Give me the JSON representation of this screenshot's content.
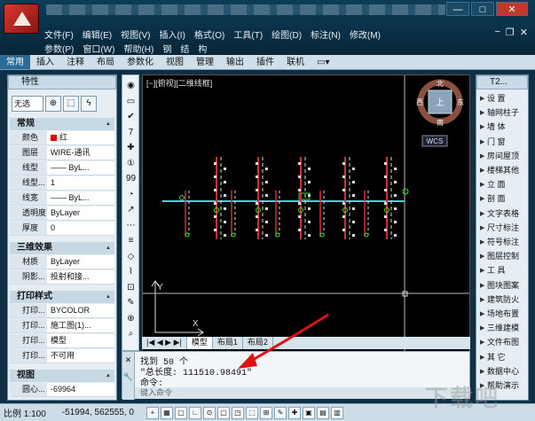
{
  "menus": {
    "row1": [
      "文件(F)",
      "编辑(E)",
      "视图(V)",
      "插入(I)",
      "格式(O)",
      "工具(T)",
      "绘图(D)",
      "标注(N)",
      "修改(M)"
    ],
    "row2": [
      "参数(P)",
      "窗口(W)",
      "帮助(H)",
      "钢",
      "结",
      "构"
    ]
  },
  "ribbon_tabs": [
    "常用",
    "插入",
    "注释",
    "布局",
    "参数化",
    "视图",
    "管理",
    "输出",
    "插件",
    "联机"
  ],
  "properties": {
    "header": "特性",
    "selector": "无选",
    "groups": [
      {
        "title": "常规",
        "rows": [
          {
            "key": "颜色",
            "value": "红"
          },
          {
            "key": "图层",
            "value": "WIRE-通讯"
          },
          {
            "key": "线型",
            "value": "—— ByL..."
          },
          {
            "key": "线型...",
            "value": "1"
          },
          {
            "key": "线宽",
            "value": "—— ByL..."
          },
          {
            "key": "透明度",
            "value": "ByLayer"
          },
          {
            "key": "厚度",
            "value": "0"
          }
        ]
      },
      {
        "title": "三维效果",
        "rows": [
          {
            "key": "材质",
            "value": "ByLayer"
          },
          {
            "key": "阴影...",
            "value": "投射和接..."
          }
        ]
      },
      {
        "title": "打印样式",
        "rows": [
          {
            "key": "打印...",
            "value": "BYCOLOR"
          },
          {
            "key": "打印...",
            "value": "施工图(1)..."
          },
          {
            "key": "打印...",
            "value": "模型"
          },
          {
            "key": "打印...",
            "value": "不可用"
          }
        ]
      },
      {
        "title": "视图",
        "rows": [
          {
            "key": "圆心...",
            "value": "-69964"
          }
        ]
      }
    ]
  },
  "viewport": {
    "label": "[−][俯视][二维线框]"
  },
  "viewcube": {
    "north": "北",
    "south": "南",
    "east": "东",
    "west": "西",
    "face": "上",
    "wcs": "WCS"
  },
  "layout_tabs": [
    "模型",
    "布局1",
    "布局2"
  ],
  "command": {
    "lines": [
      "找到 50 个",
      "\"总长度: 111510.98491\"",
      "命令:"
    ],
    "input_placeholder": "键入命令"
  },
  "right_panel": {
    "header": "T2...",
    "items": [
      "设  置",
      "轴网柱子",
      "墙  体",
      "门  窗",
      "房间屋顶",
      "楼梯其他",
      "立  面",
      "剖  面",
      "文字表格",
      "尺寸标注",
      "符号标注",
      "图层控制",
      "工  具",
      "图块图案",
      "建筑防火",
      "场地布置",
      "三维建模",
      "文件布图",
      "其  它",
      "数据中心",
      "帮助演示"
    ]
  },
  "status_bar": {
    "scale": "比例 1:100",
    "coords": "-51994, 562555, 0"
  },
  "colors": {
    "accent": "#2a6a96",
    "titlebar": "#0d3c57",
    "viewport_bg": "#000000",
    "color_red": "#dd0000"
  }
}
